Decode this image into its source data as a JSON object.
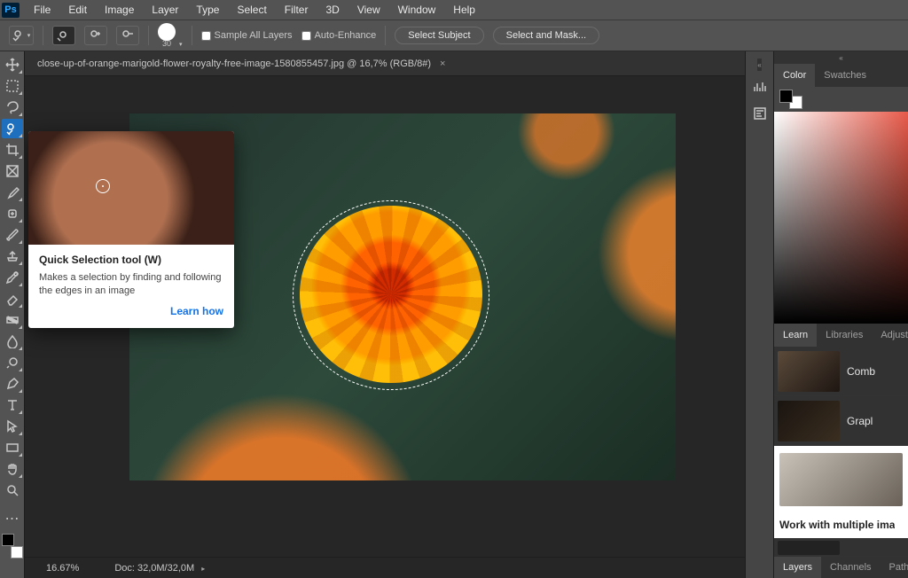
{
  "menubar": {
    "items": [
      "File",
      "Edit",
      "Image",
      "Layer",
      "Type",
      "Select",
      "Filter",
      "3D",
      "View",
      "Window",
      "Help"
    ]
  },
  "optionsBar": {
    "brushSize": "30",
    "sampleAllLayers": "Sample All Layers",
    "autoEnhance": "Auto-Enhance",
    "selectSubject": "Select Subject",
    "selectAndMask": "Select and Mask..."
  },
  "docTab": "close-up-of-orange-marigold-flower-royalty-free-image-1580855457.jpg @ 16,7%  (RGB/8#)",
  "tooltip": {
    "title": "Quick Selection tool (W)",
    "desc": "Makes a selection by finding and following the edges in an image",
    "link": "Learn how"
  },
  "status": {
    "zoom": "16.67%",
    "doc": "Doc: 32,0M/32,0M"
  },
  "panels": {
    "colorTab": "Color",
    "swatchesTab": "Swatches",
    "learnTab": "Learn",
    "librariesTab": "Libraries",
    "adjustTab": "Adjustmen",
    "learnItems": [
      "Comb",
      "Grapl",
      "Work with multiple ima"
    ],
    "layersTab": "Layers",
    "channelsTab": "Channels",
    "pathsTab": "Paths"
  }
}
